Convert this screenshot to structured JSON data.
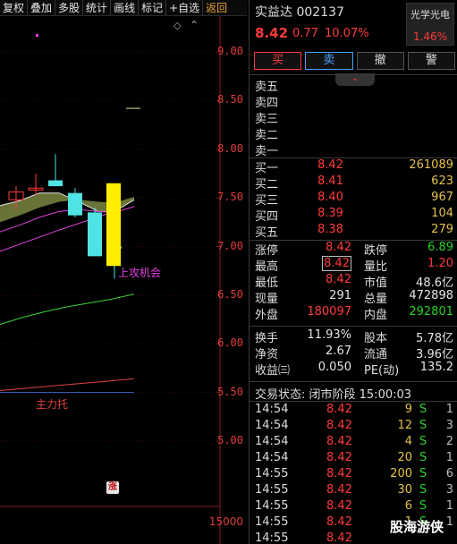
{
  "toolbar": {
    "items": [
      "复权",
      "叠加",
      "多股",
      "统计",
      "画线",
      "标记",
      "+自选",
      "返回"
    ]
  },
  "chart": {
    "price_ticks": [
      "9.00",
      "8.50",
      "8.00",
      "7.50",
      "7.00",
      "6.50",
      "6.00",
      "5.50",
      "5.00"
    ],
    "volume_tick": "15000",
    "annotation_up": "上攻机会",
    "annotation_support": "主力托",
    "badge": "涨",
    "candles": [
      {
        "o": 7.48,
        "h": 7.62,
        "l": 7.38,
        "c": 7.56,
        "color": "red"
      },
      {
        "o": 7.58,
        "h": 7.75,
        "l": 7.52,
        "c": 7.6,
        "color": "red"
      },
      {
        "o": 7.68,
        "h": 7.95,
        "l": 7.62,
        "c": 7.62,
        "color": "cyan"
      },
      {
        "o": 7.55,
        "h": 7.6,
        "l": 7.3,
        "c": 7.32,
        "color": "cyan"
      },
      {
        "o": 7.35,
        "h": 7.4,
        "l": 6.9,
        "c": 6.9,
        "color": "cyan"
      },
      {
        "o": 7.0,
        "h": 7.04,
        "l": 6.67,
        "c": 6.98,
        "color": "cyan"
      },
      {
        "o": 6.8,
        "h": 7.65,
        "l": 6.8,
        "c": 7.65,
        "color": "yellow"
      }
    ],
    "limit_up_marker": 8.42,
    "ma_series": {
      "ma_short": [
        7.42,
        7.47,
        7.55,
        7.55,
        7.46,
        7.36,
        7.36,
        7.48
      ],
      "ma_mid": [
        7.15,
        7.22,
        7.3,
        7.36,
        7.38,
        7.36,
        7.35,
        7.41
      ],
      "ma_long": [
        6.2,
        6.27,
        6.33,
        6.38,
        6.42,
        6.46,
        6.51
      ],
      "ma_xlong": [
        5.52,
        5.54,
        5.56,
        5.58,
        5.6,
        5.62,
        5.64
      ]
    },
    "colors": {
      "up": "#ff3b3b",
      "down": "#4fe3e3",
      "limit": "#ffee00",
      "ma_short": "#e0e0e0",
      "ma_mid": "#e040e0",
      "ma_long": "#39d339",
      "ma_xlong": "#e04040"
    }
  },
  "stock": {
    "name": "实益达",
    "code": "002137",
    "price": "8.42",
    "change": "0.77",
    "change_pct": "10.07%",
    "sector_name": "光学光电",
    "sector_pct": "1.46%"
  },
  "buttons": {
    "buy": "买",
    "sell": "卖",
    "cancel": "撤",
    "alert": "警"
  },
  "asks": [
    {
      "label": "卖五",
      "price": "",
      "vol": ""
    },
    {
      "label": "卖四",
      "price": "",
      "vol": ""
    },
    {
      "label": "卖三",
      "price": "",
      "vol": ""
    },
    {
      "label": "卖二",
      "price": "",
      "vol": ""
    },
    {
      "label": "卖一",
      "price": "",
      "vol": ""
    }
  ],
  "bids": [
    {
      "label": "买一",
      "price": "8.42",
      "vol": "261089"
    },
    {
      "label": "买二",
      "price": "8.41",
      "vol": "623"
    },
    {
      "label": "买三",
      "price": "8.40",
      "vol": "967"
    },
    {
      "label": "买四",
      "price": "8.39",
      "vol": "104"
    },
    {
      "label": "买五",
      "price": "8.38",
      "vol": "279"
    }
  ],
  "stats": [
    {
      "k1": "涨停",
      "v1": "8.42",
      "c1": "red",
      "k2": "跌停",
      "v2": "6.89",
      "c2": "green"
    },
    {
      "k1": "最高",
      "v1": "8.42",
      "c1": "red",
      "k2": "量比",
      "v2": "1.20",
      "c2": "red",
      "box1": true
    },
    {
      "k1": "最低",
      "v1": "8.42",
      "c1": "red",
      "k2": "市值",
      "v2": "48.6亿",
      "c2": "white"
    },
    {
      "k1": "现量",
      "v1": "291",
      "c1": "white",
      "k2": "总量",
      "v2": "472898",
      "c2": "white"
    },
    {
      "k1": "外盘",
      "v1": "180097",
      "c1": "red",
      "k2": "内盘",
      "v2": "292801",
      "c2": "green"
    }
  ],
  "stats2": [
    {
      "k1": "换手",
      "v1": "11.93%",
      "c1": "white",
      "k2": "股本",
      "v2": "5.78亿",
      "c2": "white"
    },
    {
      "k1": "净资",
      "v1": "2.67",
      "c1": "white",
      "k2": "流通",
      "v2": "3.96亿",
      "c2": "white"
    },
    {
      "k1": "收益㈢",
      "v1": "0.050",
      "c1": "white",
      "k2": "PE(动)",
      "v2": "135.2",
      "c2": "white"
    }
  ],
  "trade_status": "交易状态: 闭市阶段 15:00:03",
  "ticks": [
    {
      "t": "14:54",
      "p": "8.42",
      "v": "9",
      "s": "S",
      "n": "1"
    },
    {
      "t": "14:54",
      "p": "8.42",
      "v": "12",
      "s": "S",
      "n": "3"
    },
    {
      "t": "14:54",
      "p": "8.42",
      "v": "4",
      "s": "S",
      "n": "2"
    },
    {
      "t": "14:54",
      "p": "8.42",
      "v": "20",
      "s": "S",
      "n": "1"
    },
    {
      "t": "14:55",
      "p": "8.42",
      "v": "200",
      "s": "S",
      "n": "6"
    },
    {
      "t": "14:55",
      "p": "8.42",
      "v": "30",
      "s": "S",
      "n": "3"
    },
    {
      "t": "14:55",
      "p": "8.42",
      "v": "6",
      "s": "S",
      "n": "1"
    },
    {
      "t": "14:55",
      "p": "8.42",
      "v": "1",
      "s": "S",
      "n": "1"
    },
    {
      "t": "14:55",
      "p": "8.42",
      "v": "",
      "s": "",
      "n": ""
    }
  ],
  "watermark": "股海游侠"
}
